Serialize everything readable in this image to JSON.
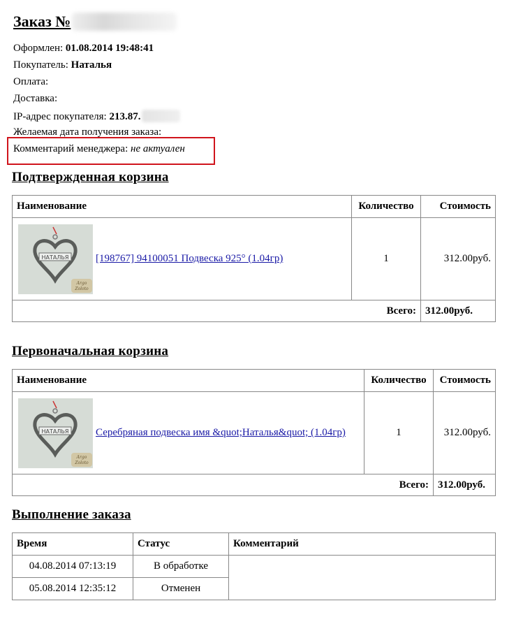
{
  "order": {
    "title_prefix": "Заказ №",
    "placed_label": "Оформлен:",
    "placed_value": "01.08.2014 19:48:41",
    "buyer_label": "Покупатель:",
    "buyer_value": "Наталья",
    "payment_label": "Оплата:",
    "delivery_label": "Доставка:",
    "ip_label": "IP-адрес покупателя:",
    "ip_value": "213.87.",
    "desired_date_label": "Желаемая дата получения заказа:",
    "manager_comment_label": "Комментарий менеджера:",
    "manager_comment_value": "не актуален"
  },
  "confirmed_cart": {
    "heading": "Подтвержденная корзина",
    "col_name": "Наименование",
    "col_qty": "Количество",
    "col_cost": "Стоимость",
    "item_link": "[198767] 94100051 Подвеска 925° (1.04гр)",
    "item_qty": "1",
    "item_cost": "312.00руб.",
    "total_label": "Всего:",
    "total_value": "312.00руб."
  },
  "original_cart": {
    "heading": "Первоначальная корзина",
    "col_name": "Наименование",
    "col_qty": "Количество",
    "col_cost": "Стоимость",
    "item_link": "Серебряная подвеска имя &quot;Наталья&quot; (1.04гр)",
    "item_qty": "1",
    "item_cost": "312.00руб.",
    "total_label": "Всего:",
    "total_value": "312.00руб."
  },
  "history": {
    "heading": "Выполнение заказа",
    "col_time": "Время",
    "col_status": "Статус",
    "col_comment": "Комментарий",
    "rows": [
      {
        "time": "04.08.2014 07:13:19",
        "status": "В обработке"
      },
      {
        "time": "05.08.2014 12:35:12",
        "status": "Отменен"
      }
    ]
  },
  "pendant_text": "НАТАЛЬЯ",
  "brand_text": "Argo Zoloto"
}
